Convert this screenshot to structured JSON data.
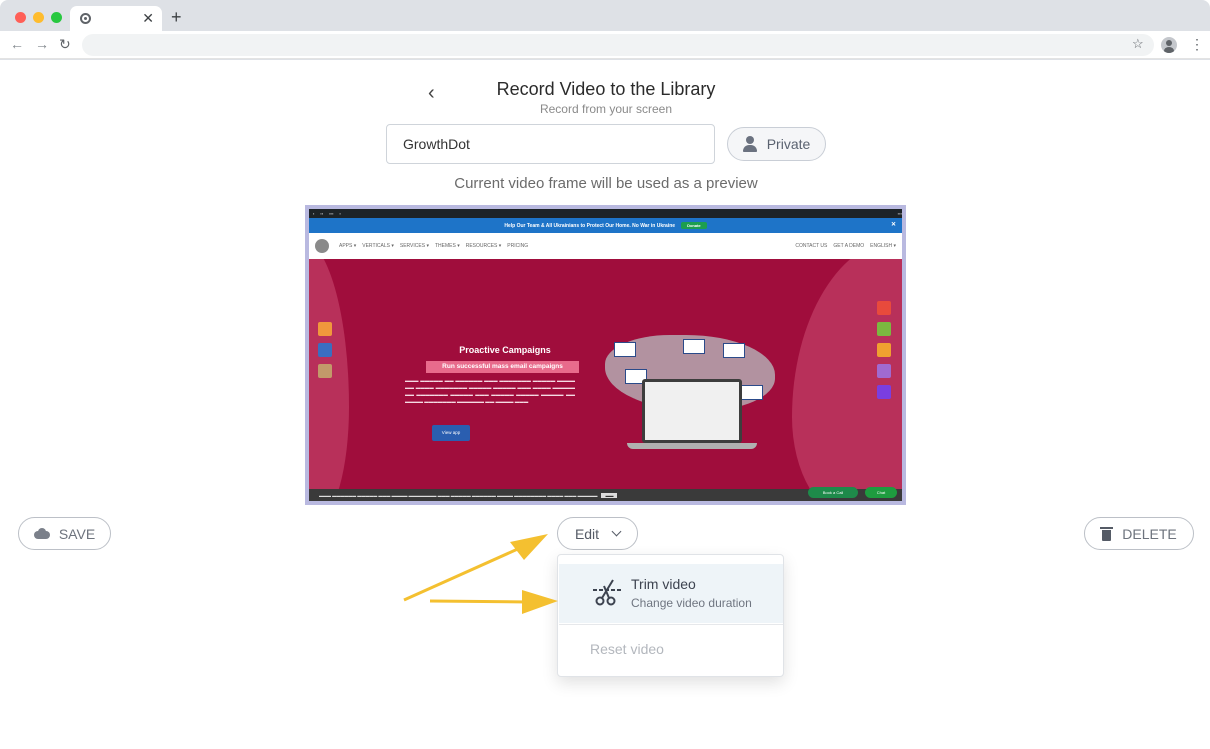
{
  "browser": {
    "tab_close": "✕",
    "new_tab": "+",
    "back": "←",
    "forward": "→",
    "reload": "↻",
    "star": "☆",
    "menu": "⋮"
  },
  "header": {
    "back": "‹",
    "title": "Record Video to the Library",
    "subtitle": "Record from your screen"
  },
  "form": {
    "name_value": "GrowthDot",
    "privacy_label": "Private"
  },
  "preview_note": "Current video frame will be used as a preview",
  "video_frame": {
    "notice": "Help Our Team & All Ukrainians to Protect Our Home. No War in Ukraine",
    "donate": "Donate",
    "nav_items": [
      "APPS ▾",
      "VERTICALS ▾",
      "SERVICES ▾",
      "THEMES ▾",
      "RESOURCES ▾",
      "PRICING"
    ],
    "nav_right": [
      "CONTACT US",
      "GET A DEMO",
      "ENGLISH ▾"
    ],
    "hero_title": "Proactive Campaigns",
    "hero_tag": "Run successful mass email campaigns",
    "hero_button": "View app",
    "book_call": "Book a Call",
    "chat": "Chat"
  },
  "actions": {
    "save_label": "SAVE",
    "edit_label": "Edit",
    "delete_label": "DELETE"
  },
  "edit_menu": {
    "trim_title": "Trim video",
    "trim_subtitle": "Change video duration",
    "reset_label": "Reset video"
  },
  "colors": {
    "arrow": "#f4c030",
    "hero": "#a00d3c",
    "notice_bar": "#1e74c8"
  }
}
